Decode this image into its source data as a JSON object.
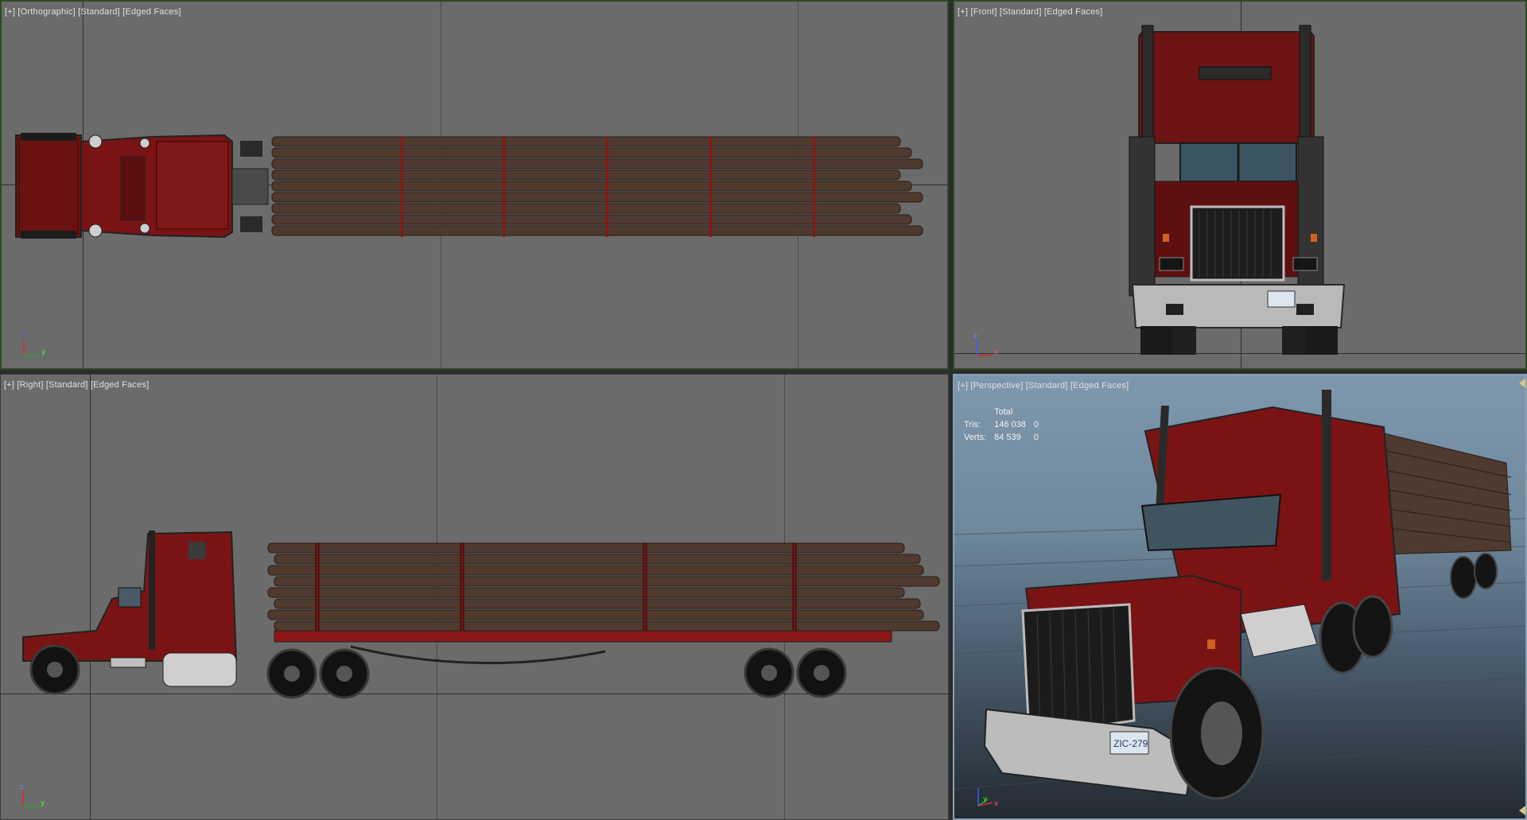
{
  "viewports": {
    "top": {
      "label": "[+] [Orthographic] [Standard] [Edged Faces]"
    },
    "front": {
      "label": "[+] [Front] [Standard] [Edged Faces]"
    },
    "right": {
      "label": "[+] [Right] [Standard] [Edged Faces]"
    },
    "persp": {
      "label": "[+] [Perspective] [Standard] [Edged Faces]"
    }
  },
  "stats": {
    "header": "Total",
    "rows": [
      {
        "label": "Tris:",
        "total": "146 038",
        "selected": "0"
      },
      {
        "label": "Verts:",
        "total": "84 539",
        "selected": "0"
      }
    ]
  },
  "axes": {
    "top": {
      "a": "z",
      "b": "y"
    },
    "front": {
      "a": "z",
      "b": "x"
    },
    "right": {
      "a": "z",
      "b": "y"
    },
    "persp": {
      "a": "y",
      "b": "x"
    }
  },
  "plate_text": "ZIC-279",
  "colors": {
    "cab_red": "#7a1414",
    "log_brown": "#4e3a2e",
    "tire": "#1b1b1b",
    "chrome": "#c9c9c9"
  }
}
